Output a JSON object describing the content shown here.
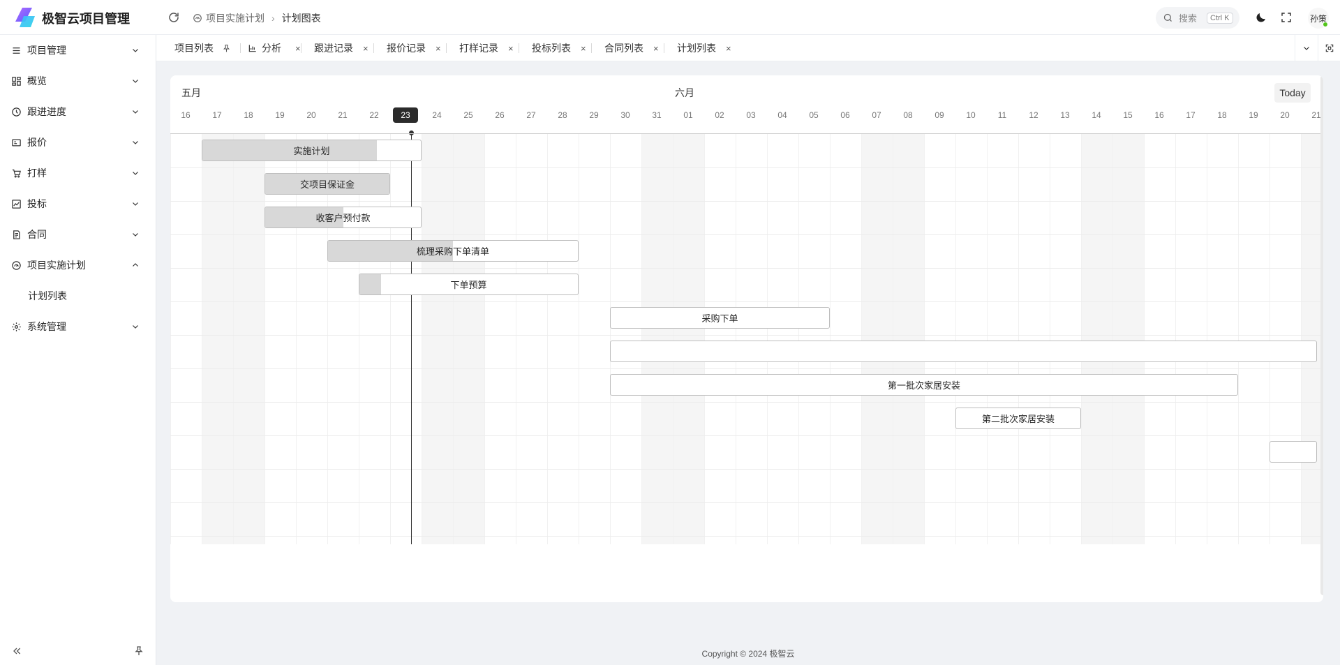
{
  "app": {
    "title": "极智云项目管理"
  },
  "breadcrumb": {
    "parent": "项目实施计划",
    "current": "计划图表"
  },
  "search": {
    "placeholder": "搜索",
    "shortcut": "Ctrl K"
  },
  "user": {
    "name": "孙策"
  },
  "sidebar": {
    "items": [
      {
        "label": "项目管理",
        "icon": "list-icon"
      },
      {
        "label": "概览",
        "icon": "dashboard-icon"
      },
      {
        "label": "跟进进度",
        "icon": "history-icon"
      },
      {
        "label": "报价",
        "icon": "quote-icon"
      },
      {
        "label": "打样",
        "icon": "cart-icon"
      },
      {
        "label": "投标",
        "icon": "chart-image-icon"
      },
      {
        "label": "合同",
        "icon": "contract-icon"
      },
      {
        "label": "项目实施计划",
        "icon": "gauge-icon",
        "expanded": true,
        "children": [
          {
            "label": "计划列表"
          }
        ]
      },
      {
        "label": "系统管理",
        "icon": "gear-icon"
      }
    ]
  },
  "tabs": [
    {
      "label": "项目列表",
      "pinned": true
    },
    {
      "label": "分析",
      "closable": true
    },
    {
      "label": "跟进记录",
      "closable": true
    },
    {
      "label": "报价记录",
      "closable": true
    },
    {
      "label": "打样记录",
      "closable": true
    },
    {
      "label": "投标列表",
      "closable": true
    },
    {
      "label": "合同列表",
      "closable": true
    },
    {
      "label": "计划列表",
      "closable": true
    }
  ],
  "close_glyph": "×",
  "gantt": {
    "months": [
      "五月",
      "六月"
    ],
    "today_label": "Today",
    "today_index": 7,
    "days": [
      "16",
      "17",
      "18",
      "19",
      "20",
      "21",
      "22",
      "23",
      "24",
      "25",
      "26",
      "27",
      "28",
      "29",
      "30",
      "31",
      "01",
      "02",
      "03",
      "04",
      "05",
      "06",
      "07",
      "08",
      "09",
      "10",
      "11",
      "12",
      "13",
      "14",
      "15",
      "16",
      "17",
      "18",
      "19",
      "20",
      "21"
    ],
    "weekend_spans": [
      [
        1,
        2
      ],
      [
        8,
        9
      ],
      [
        15,
        16
      ],
      [
        22,
        23
      ],
      [
        29,
        30
      ],
      [
        36,
        37
      ]
    ],
    "tasks": [
      {
        "name": "实施计划",
        "start": 1,
        "end": 8,
        "progress": 0.8
      },
      {
        "name": "交项目保证金",
        "start": 3,
        "end": 7,
        "progress": 1.0
      },
      {
        "name": "收客户预付款",
        "start": 3,
        "end": 8,
        "progress": 0.5
      },
      {
        "name": "梳理采购下单清单",
        "start": 5,
        "end": 13,
        "progress": 0.5
      },
      {
        "name": "下单预算",
        "start": 6,
        "end": 13,
        "progress": 0.1
      },
      {
        "name": "采购下单",
        "start": 14,
        "end": 21,
        "progress": 0
      },
      {
        "name": "",
        "start": 14,
        "end": 36.5,
        "progress": 0
      },
      {
        "name": "第一批次家居安装",
        "start": 14,
        "end": 34,
        "progress": 0
      },
      {
        "name": "第二批次家居安装",
        "start": 25,
        "end": 29,
        "progress": 0
      },
      {
        "name": "",
        "start": 35,
        "end": 36.5,
        "progress": 0
      }
    ]
  },
  "footer": {
    "copyright": "Copyright © 2024 极智云"
  }
}
